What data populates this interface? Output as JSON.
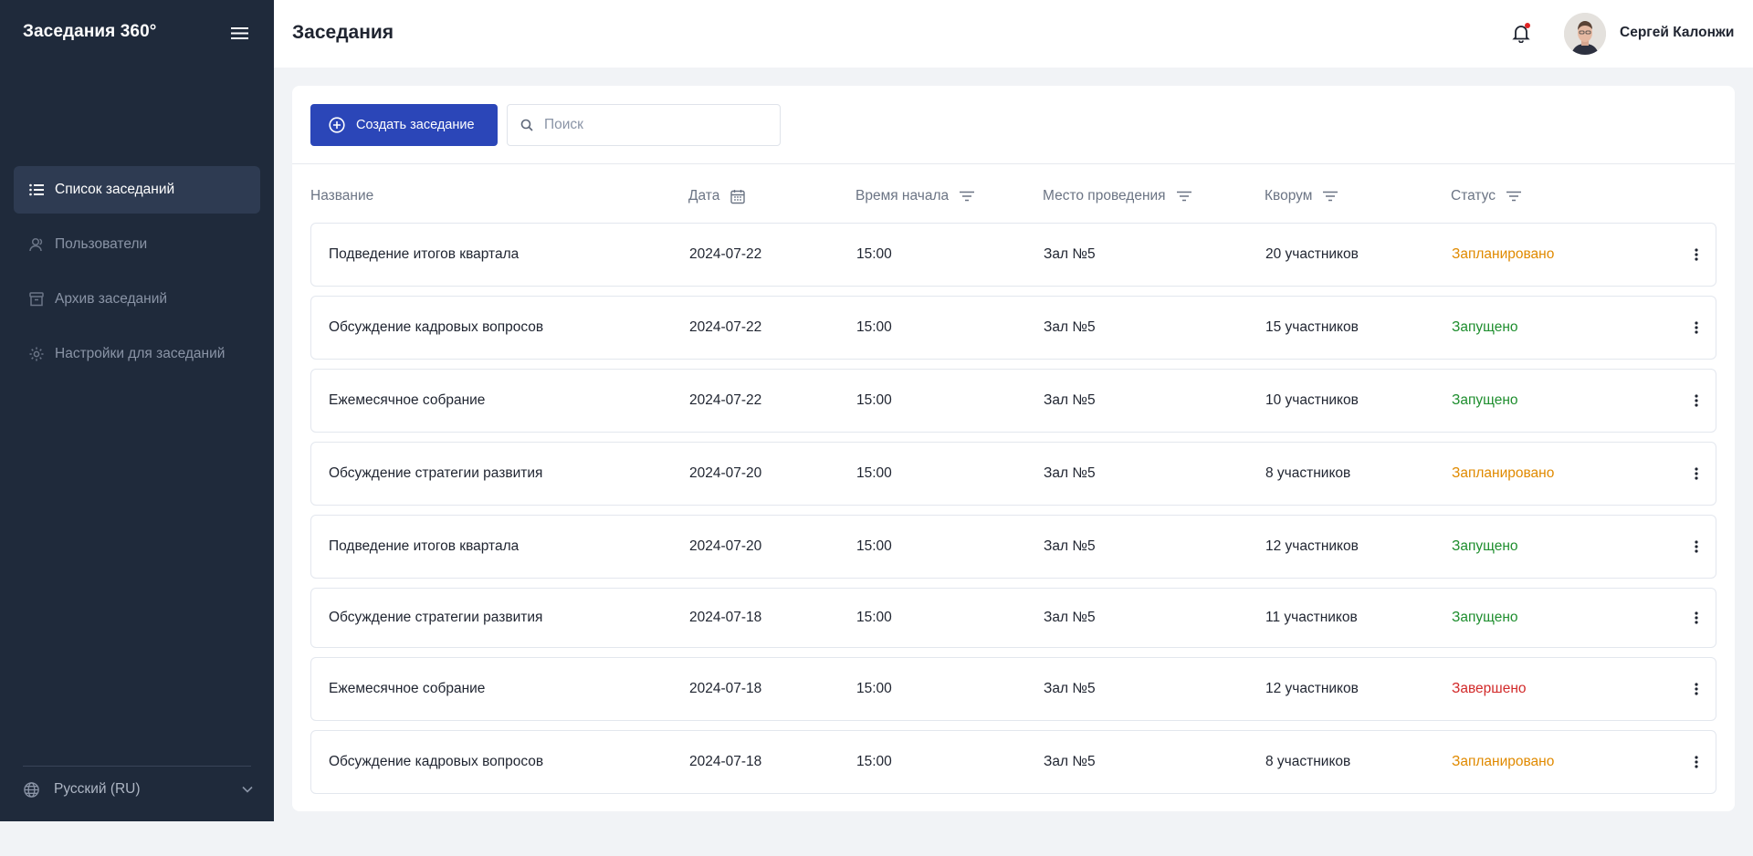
{
  "app": {
    "brand": "Заседания 360°"
  },
  "sidebar": {
    "items": [
      {
        "label": "Список заседаний",
        "icon": "list-icon",
        "active": true
      },
      {
        "label": "Пользователи",
        "icon": "users-icon",
        "active": false
      },
      {
        "label": "Архив заседаний",
        "icon": "archive-icon",
        "active": false
      },
      {
        "label": "Настройки для заседаний",
        "icon": "settings-icon",
        "active": false
      }
    ],
    "language": "Русский (RU)"
  },
  "header": {
    "title": "Заседания",
    "user_name": "Сергей Калонжи",
    "has_notification": true
  },
  "toolbar": {
    "create_label": "Создать заседание",
    "search_placeholder": "Поиск",
    "search_value": ""
  },
  "table": {
    "columns": [
      "Название",
      "Дата",
      "Время начала",
      "Место проведения",
      "Кворум",
      "Статус"
    ],
    "rows": [
      {
        "title": "Подведение итогов квартала",
        "date": "2024-07-22",
        "time": "15:00",
        "place": "Зал №5",
        "quorum": "20 участников",
        "status": "Запланировано",
        "status_type": "planned"
      },
      {
        "title": "Обсуждение кадровых вопросов",
        "date": "2024-07-22",
        "time": "15:00",
        "place": "Зал №5",
        "quorum": "15 участников",
        "status": "Запущено",
        "status_type": "running"
      },
      {
        "title": "Ежемесячное собрание",
        "date": "2024-07-22",
        "time": "15:00",
        "place": "Зал №5",
        "quorum": "10 участников",
        "status": "Запущено",
        "status_type": "running"
      },
      {
        "title": "Обсуждение стратегии развития",
        "date": "2024-07-20",
        "time": "15:00",
        "place": "Зал №5",
        "quorum": "8 участников",
        "status": "Запланировано",
        "status_type": "planned"
      },
      {
        "title": "Подведение итогов квартала",
        "date": "2024-07-20",
        "time": "15:00",
        "place": "Зал №5",
        "quorum": "12 участников",
        "status": "Запущено",
        "status_type": "running"
      },
      {
        "title": "Обсуждение стратегии развития",
        "date": "2024-07-18",
        "time": "15:00",
        "place": "Зал №5",
        "quorum": "11 участников",
        "status": "Запущено",
        "status_type": "running"
      },
      {
        "title": "Ежемесячное собрание",
        "date": "2024-07-18",
        "time": "15:00",
        "place": "Зал №5",
        "quorum": "12 участников",
        "status": "Завершено",
        "status_type": "finished"
      },
      {
        "title": "Обсуждение кадровых вопросов",
        "date": "2024-07-18",
        "time": "15:00",
        "place": "Зал №5",
        "quorum": "8 участников",
        "status": "Запланировано",
        "status_type": "planned"
      }
    ]
  },
  "colors": {
    "sidebar_bg": "#1f2a3b",
    "accent": "#2b46b8",
    "status_planned": "#e08a00",
    "status_running": "#1e8e2e",
    "status_finished": "#d22a2a"
  }
}
